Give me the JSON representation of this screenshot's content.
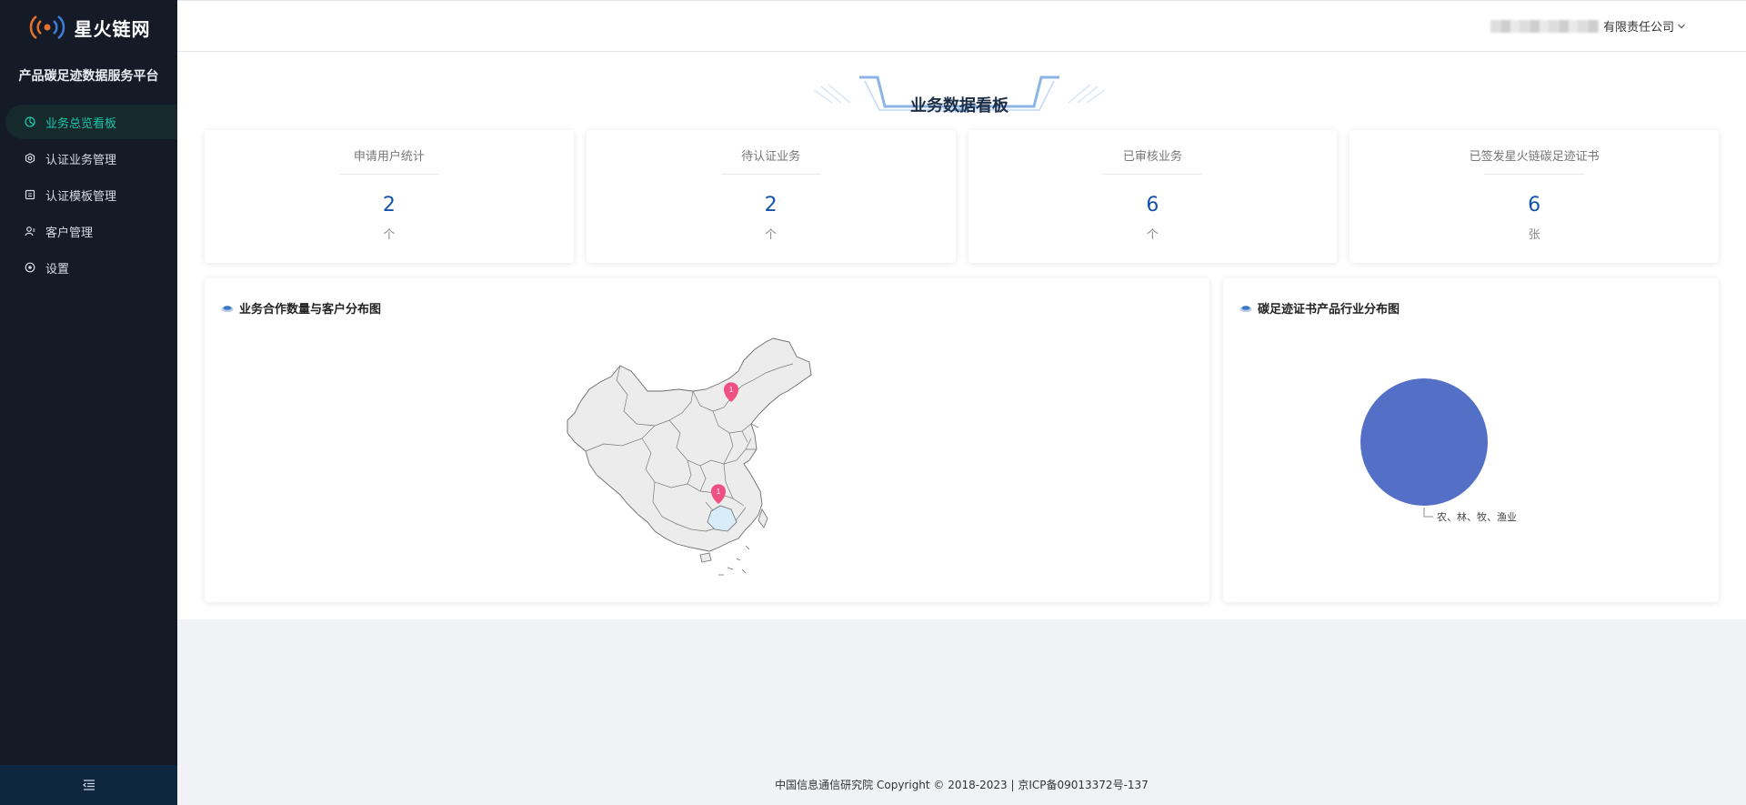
{
  "sidebar": {
    "logo_text": "星火链网",
    "platform_name": "产品碳足迹数据服务平台",
    "items": [
      {
        "label": "业务总览看板",
        "icon": "dashboard-icon",
        "active": true
      },
      {
        "label": "认证业务管理",
        "icon": "gear-icon",
        "active": false
      },
      {
        "label": "认证模板管理",
        "icon": "template-icon",
        "active": false
      },
      {
        "label": "客户管理",
        "icon": "user-icon",
        "active": false
      },
      {
        "label": "设置",
        "icon": "settings-icon",
        "active": false
      }
    ],
    "collapse_icon": "collapse-menu-icon"
  },
  "header": {
    "company_name": "有限责任公司",
    "dropdown_icon": "chevron-down-icon"
  },
  "dashboard": {
    "title": "业务数据看板",
    "cards": [
      {
        "title": "申请用户统计",
        "value": "2",
        "unit": "个"
      },
      {
        "title": "待认证业务",
        "value": "2",
        "unit": "个"
      },
      {
        "title": "已审核业务",
        "value": "6",
        "unit": "个"
      },
      {
        "title": "已签发星火链碳足迹证书",
        "value": "6",
        "unit": "张"
      }
    ],
    "map_panel": {
      "title": "业务合作数量与客户分布图",
      "pins": [
        {
          "label": "1",
          "region": "北京"
        },
        {
          "label": "1",
          "region": "广东"
        }
      ]
    },
    "pie_panel": {
      "title": "碳足迹证书产品行业分布图"
    }
  },
  "chart_data": {
    "type": "pie",
    "title": "",
    "slices": [
      {
        "label": "农、林、牧、渔业",
        "value": 1
      }
    ],
    "colors": [
      "#5470c6"
    ]
  },
  "footer": {
    "text": "中国信息通信研究院 Copyright © 2018-2023 | 京ICP备09013372号-137"
  },
  "colors": {
    "sidebar_bg": "#141a26",
    "active_text": "#1cc4a8",
    "value_blue": "#1553a8",
    "pin_pink": "#ef4f82",
    "pie_blue": "#5470c6"
  }
}
